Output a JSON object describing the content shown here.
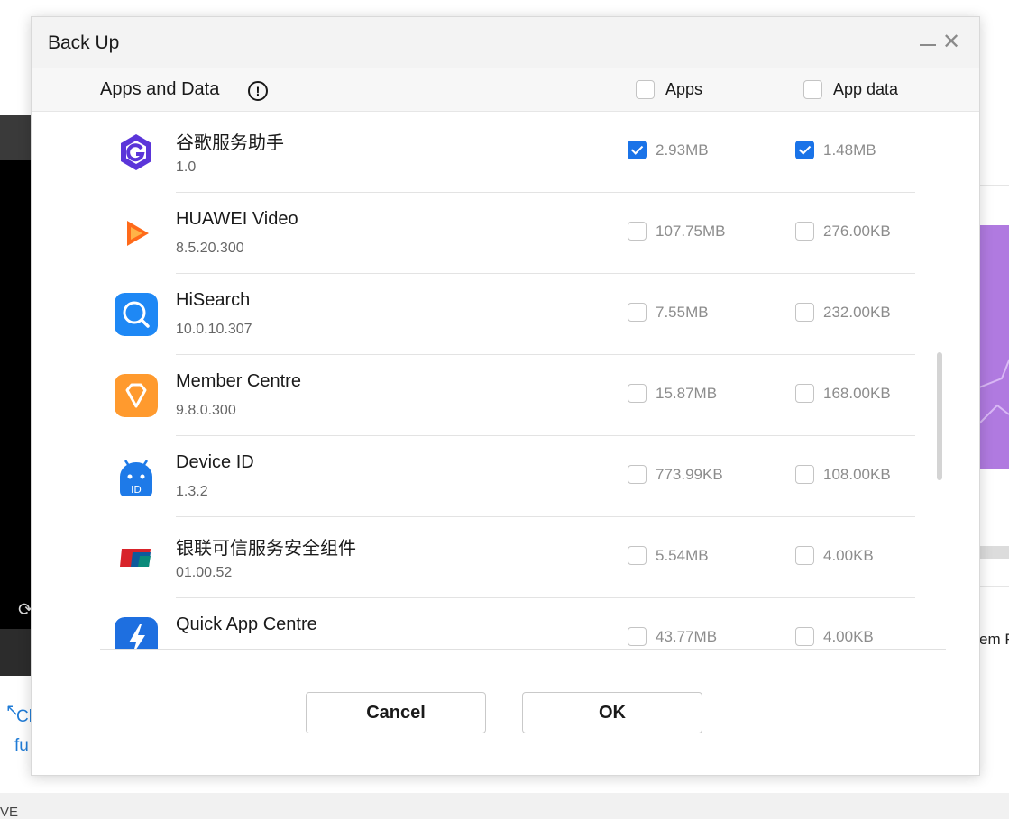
{
  "background": {
    "left_text_line1": "Cl",
    "left_text_line2": "fu",
    "right_text": "em R",
    "bottom_text": "VE"
  },
  "dialog": {
    "title": "Back Up",
    "header": {
      "section_title": "Apps and Data",
      "info_symbol": "!",
      "col_apps_label": "Apps",
      "col_app_data_label": "App data"
    },
    "apps": [
      {
        "name": "谷歌服务助手",
        "version": "1.0",
        "apps_size": "2.93MB",
        "data_size": "1.48MB",
        "apps_checked": true,
        "data_checked": true,
        "icon": "google-services-icon"
      },
      {
        "name": "HUAWEI Video",
        "version": "8.5.20.300",
        "apps_size": "107.75MB",
        "data_size": "276.00KB",
        "apps_checked": false,
        "data_checked": false,
        "icon": "huawei-video-icon"
      },
      {
        "name": "HiSearch",
        "version": "10.0.10.307",
        "apps_size": "7.55MB",
        "data_size": "232.00KB",
        "apps_checked": false,
        "data_checked": false,
        "icon": "hisearch-icon"
      },
      {
        "name": "Member Centre",
        "version": "9.8.0.300",
        "apps_size": "15.87MB",
        "data_size": "168.00KB",
        "apps_checked": false,
        "data_checked": false,
        "icon": "member-centre-icon"
      },
      {
        "name": "Device ID",
        "version": "1.3.2",
        "apps_size": "773.99KB",
        "data_size": "108.00KB",
        "apps_checked": false,
        "data_checked": false,
        "icon": "device-id-icon"
      },
      {
        "name": "银联可信服务安全组件",
        "version": "01.00.52",
        "apps_size": "5.54MB",
        "data_size": "4.00KB",
        "apps_checked": false,
        "data_checked": false,
        "icon": "unionpay-icon"
      },
      {
        "name": "Quick App Centre",
        "version": "",
        "apps_size": "43.77MB",
        "data_size": "4.00KB",
        "apps_checked": false,
        "data_checked": false,
        "icon": "quick-app-centre-icon"
      }
    ],
    "buttons": {
      "cancel": "Cancel",
      "ok": "OK"
    },
    "colors": {
      "accent": "#1a73e8"
    }
  }
}
